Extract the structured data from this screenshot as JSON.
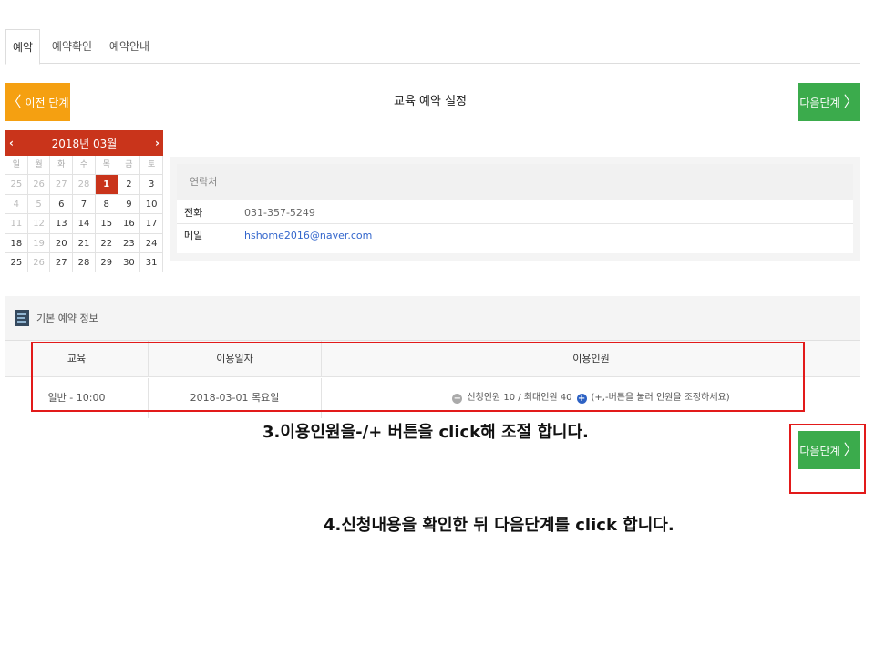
{
  "tabs": [
    {
      "label": "예약",
      "active": true
    },
    {
      "label": "예약확인",
      "active": false
    },
    {
      "label": "예약안내",
      "active": false
    }
  ],
  "nav": {
    "prev_label": "이전 단계",
    "next_label": "다음단계",
    "prev_color": "#f5a011",
    "next_color": "#3bab4c"
  },
  "page_title": "교육 예약 설정",
  "calendar": {
    "title": "2018년 03월",
    "header_color": "#c9341b",
    "weekdays": [
      "일",
      "월",
      "화",
      "수",
      "목",
      "금",
      "토"
    ],
    "weeks": [
      [
        "25",
        "26",
        "27",
        "28",
        "1",
        "2",
        "3"
      ],
      [
        "4",
        "5",
        "6",
        "7",
        "8",
        "9",
        "10"
      ],
      [
        "11",
        "12",
        "13",
        "14",
        "15",
        "16",
        "17"
      ],
      [
        "18",
        "19",
        "20",
        "21",
        "22",
        "23",
        "24"
      ],
      [
        "25",
        "26",
        "27",
        "28",
        "29",
        "30",
        "31"
      ]
    ],
    "selected": "1"
  },
  "contact": {
    "heading": "연락처",
    "phone_label": "전화",
    "phone": "031-357-5249",
    "email_label": "메일",
    "email": "hshome2016@naver.com"
  },
  "reservation_info": {
    "heading": "기본 예약 정보",
    "columns": [
      "교육",
      "이용일자",
      "이용인원"
    ],
    "row": {
      "program": "일반 - 10:00",
      "date": "2018-03-01 목요일",
      "count": "신청인원 10 / 최대인원 40",
      "hint": "(+,-버튼을 눌러 인원을 조정하세요)"
    }
  },
  "annotations": {
    "step3": "3.이용인원을-/+ 버튼을 click해 조절 합니다.",
    "step4": "4.신청내용을 확인한 뒤 다음단계를 click 합니다."
  }
}
